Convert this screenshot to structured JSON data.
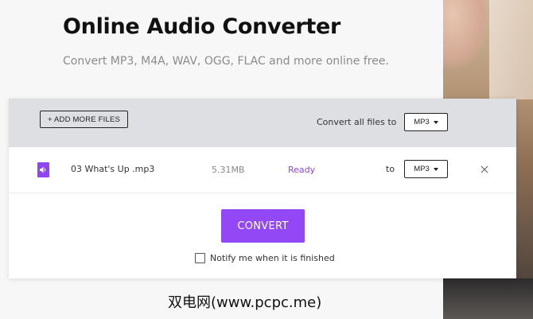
{
  "header": {
    "title": "Online Audio Converter",
    "subtitle": "Convert MP3, M4A, WAV, OGG, FLAC and more online free."
  },
  "toolbar": {
    "add_files_label": "+ ADD MORE FILES",
    "convert_all_label": "Convert all files to",
    "convert_all_format": "MP3"
  },
  "files": [
    {
      "name": "03 What's Up .mp3",
      "size": "5.31MB",
      "status": "Ready",
      "to_label": "to",
      "format": "MP3"
    }
  ],
  "actions": {
    "convert_label": "CONVERT",
    "notify_label": "Notify me when it is finished",
    "notify_checked": false
  },
  "watermark": "双电网(www.pcpc.me)",
  "colors": {
    "accent": "#9249f5",
    "status_ready": "#8f45f0",
    "header_bar": "#dedfe3"
  },
  "icons": {
    "file": "audio-file-icon",
    "close": "close-icon",
    "dropdown": "caret-down-icon"
  }
}
